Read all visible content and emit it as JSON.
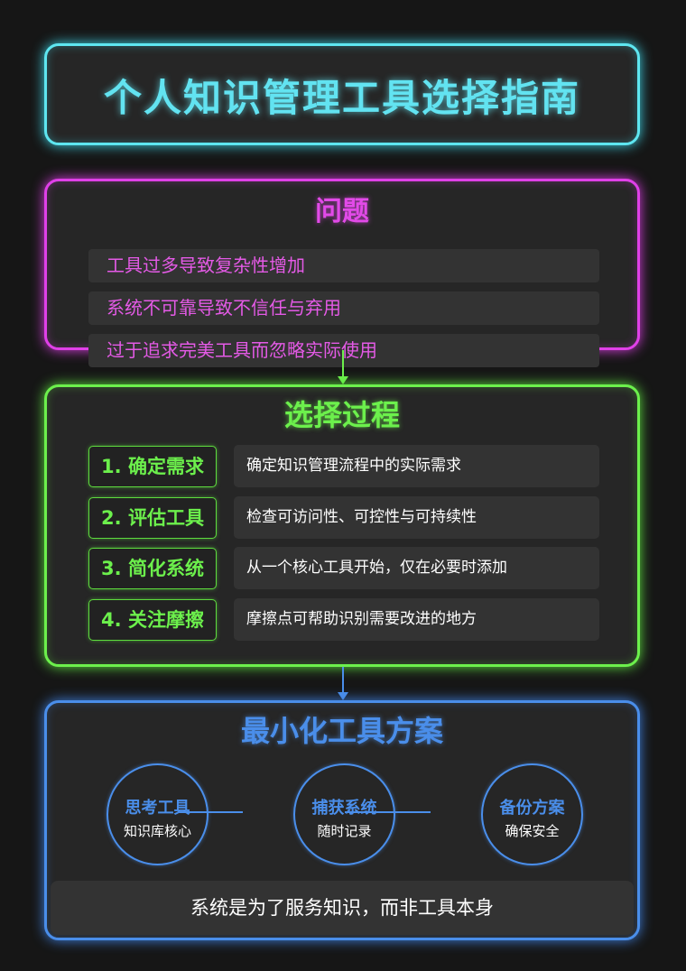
{
  "title": "个人知识管理工具选择指南",
  "colors": {
    "title": "#62e3f1",
    "problem": "#e24ae8",
    "process": "#6cf04c",
    "solution": "#4a8eea",
    "background": "#161616",
    "panel": "#262626"
  },
  "problem": {
    "title": "问题",
    "items": [
      "工具过多导致复杂性增加",
      "系统不可靠导致不信任与弃用",
      "过于追求完美工具而忽略实际使用"
    ]
  },
  "process": {
    "title": "选择过程",
    "steps": [
      {
        "label": "1. 确定需求",
        "desc": "确定知识管理流程中的实际需求"
      },
      {
        "label": "2. 评估工具",
        "desc": "检查可访问性、可控性与可持续性"
      },
      {
        "label": "3. 简化系统",
        "desc": "从一个核心工具开始，仅在必要时添加"
      },
      {
        "label": "4. 关注摩擦",
        "desc": "摩擦点可帮助识别需要改进的地方"
      }
    ]
  },
  "solution": {
    "title": "最小化工具方案",
    "tools": [
      {
        "name": "思考工具",
        "desc": "知识库核心"
      },
      {
        "name": "捕获系统",
        "desc": "随时记录"
      },
      {
        "name": "备份方案",
        "desc": "确保安全"
      }
    ],
    "footer": "系统是为了服务知识，而非工具本身"
  }
}
